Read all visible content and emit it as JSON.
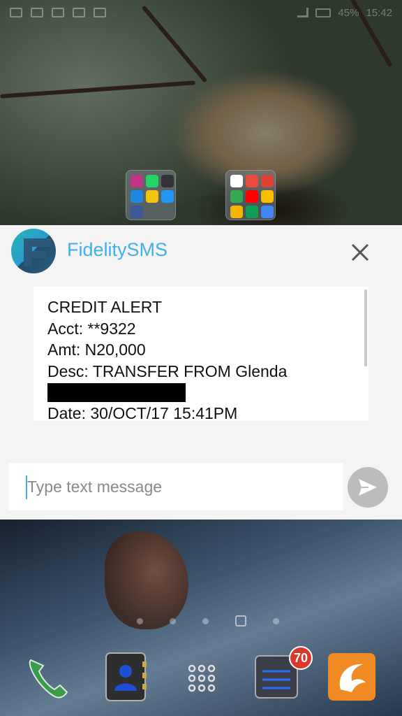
{
  "status_bar": {
    "battery": "45%",
    "time": "15:42"
  },
  "popup": {
    "app_name": "FidelitySMS",
    "message_lines": [
      "CREDIT ALERT",
      "Acct: **9322",
      "Amt: N20,000",
      "Desc: TRANSFER FROM Glenda",
      "Date: 30/OCT/17 15:41PM"
    ],
    "input_placeholder": "Type text message",
    "accent_color": "#3fb1e6"
  },
  "home": {
    "folders": [
      {
        "name": "social-folder",
        "icons": [
          "instagram-icon",
          "whatsapp-icon",
          "camera-icon",
          "messenger-icon",
          "mtn-icon",
          "app-icon",
          "facebook-icon"
        ]
      },
      {
        "name": "google-folder",
        "icons": [
          "google-icon",
          "chrome-icon",
          "gmail-icon",
          "maps-icon",
          "youtube-icon",
          "drive-icon",
          "chrome-icon",
          "hangouts-icon",
          "photos-icon"
        ]
      }
    ],
    "dock": [
      "phone-icon",
      "contacts-icon",
      "apps-grid-icon",
      "messages-icon",
      "browser-icon"
    ],
    "messages_badge": "70"
  }
}
